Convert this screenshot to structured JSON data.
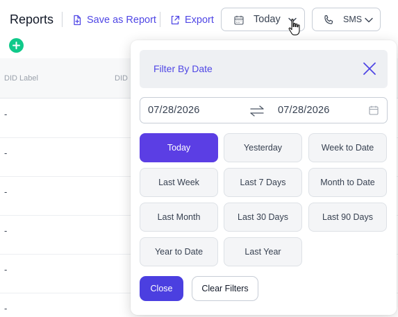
{
  "toolbar": {
    "title": "Reports",
    "save_label": "Save as Report",
    "export_label": "Export",
    "date_filter_label": "Today",
    "channel_label": "SMS"
  },
  "table": {
    "headers": [
      "DID Label",
      "DID"
    ],
    "rows": [
      {
        "cell": "-"
      },
      {
        "cell": "-"
      },
      {
        "cell": "-"
      },
      {
        "cell": "-"
      },
      {
        "cell": "-"
      },
      {
        "cell": "-"
      }
    ]
  },
  "date_filter": {
    "title": "Filter By Date",
    "start_date": "07/28/2026",
    "end_date": "07/28/2026",
    "selected": "Today",
    "presets": [
      "Today",
      "Yesterday",
      "Week to Date",
      "Last Week",
      "Last 7 Days",
      "Month to Date",
      "Last Month",
      "Last 30 Days",
      "Last 90 Days",
      "Year to Date",
      "Last Year"
    ],
    "close_label": "Close",
    "clear_label": "Clear Filters"
  },
  "colors": {
    "accent": "#4f46e5",
    "active_preset": "#5b3ee4",
    "add_button": "#10c98a"
  },
  "icons": [
    "file-plus-icon",
    "export-icon",
    "calendar-icon",
    "chevron-down-icon",
    "phone-icon",
    "plus-icon",
    "close-icon",
    "swap-icon",
    "cursor-hand-icon"
  ]
}
